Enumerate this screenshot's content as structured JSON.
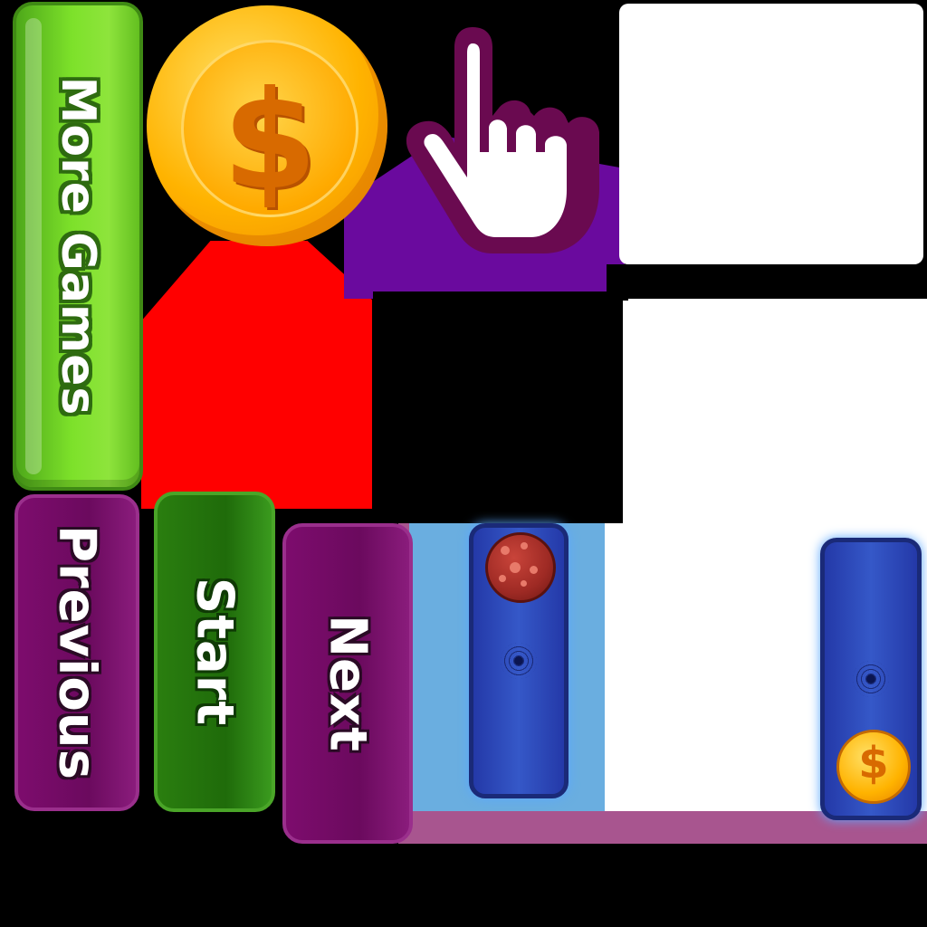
{
  "buttons": {
    "more_games": "More Games",
    "previous": "Previous",
    "start": "Start",
    "next": "Next"
  },
  "coins": {
    "big_symbol": "$",
    "small_symbol": "$"
  },
  "icons": {
    "hand": "pointing-hand-icon",
    "coin": "coin-icon",
    "meteor": "meteor-icon"
  },
  "colors": {
    "green_button": "#7de12a",
    "dark_green_button": "#1f6b0a",
    "purple_button": "#6b0a5e",
    "slider_blue": "#3558c8",
    "coin_gold": "#ffb300"
  }
}
